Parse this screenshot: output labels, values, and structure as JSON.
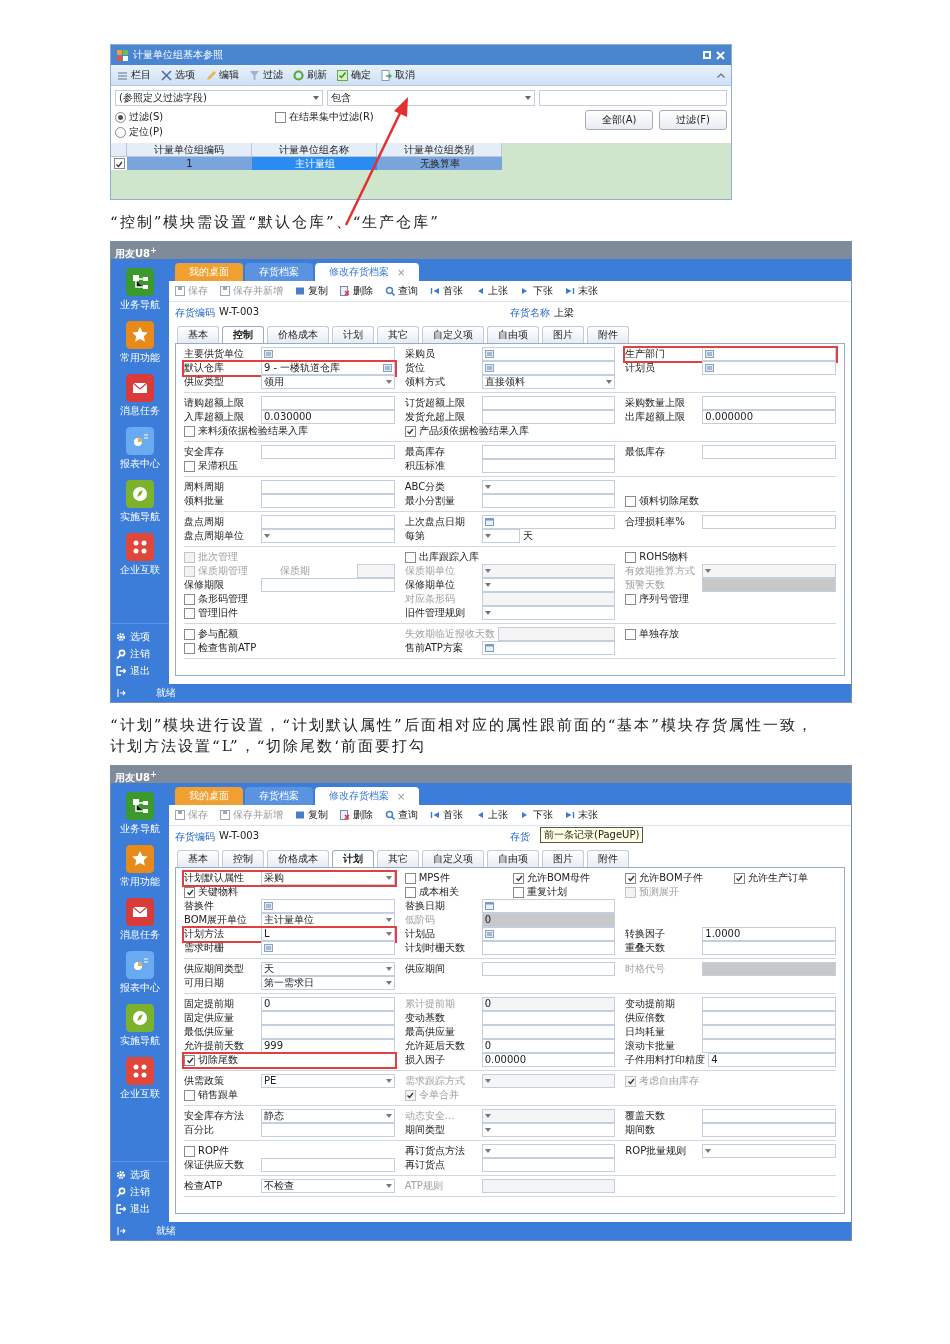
{
  "dialog": {
    "title": "计量单位组基本参照",
    "toolbar": [
      {
        "label": "栏目"
      },
      {
        "label": "选项"
      },
      {
        "label": "编辑"
      },
      {
        "label": "过滤"
      },
      {
        "label": "刷新"
      },
      {
        "label": "确定"
      },
      {
        "label": "取消"
      }
    ],
    "filter_field": "(参照定义过滤字段)",
    "filter_operator": "包含",
    "modes": [
      {
        "label": "过滤(S)",
        "selected": true
      },
      {
        "label": "定位(P)",
        "selected": false
      }
    ],
    "in_result": {
      "label": "在结果集中过滤(R)",
      "checked": false
    },
    "buttons": [
      "全部(A)",
      "过滤(F)"
    ],
    "table": {
      "columns": [
        "计量单位组编码",
        "计量单位组名称",
        "计量单位组类别"
      ],
      "rows": [
        {
          "checked": true,
          "selected": true,
          "cells": [
            {
              "text": "1",
              "focused": false
            },
            {
              "text": "主计量组",
              "focused": true
            },
            {
              "text": "无换算率",
              "focused": false
            }
          ]
        }
      ]
    }
  },
  "caption_1": "“控制”模块需设置“默认仓库”、“生产仓库”",
  "control_screen": {
    "app_title": "用友U8$^{+}$",
    "sidebar": {
      "items": [
        {
          "label": "业务导航",
          "color": "#3c9a2c"
        },
        {
          "label": "常用功能",
          "color": "#e88a1a"
        },
        {
          "label": "消息任务",
          "color": "#d93a3a"
        },
        {
          "label": "报表中心",
          "color": "#6aaaf0"
        },
        {
          "label": "实施导航",
          "color": "#7db32c"
        },
        {
          "label": "企业互联",
          "color": "#e0463a"
        }
      ],
      "bottom": [
        {
          "label": "选项"
        },
        {
          "label": "注销"
        },
        {
          "label": "退出"
        }
      ]
    },
    "tabs": [
      {
        "label": "我的桌面",
        "kind": "home",
        "selected": false
      },
      {
        "label": "存货档案",
        "kind": "doc",
        "selected": false
      },
      {
        "label": "修改存货档案",
        "kind": "doc",
        "selected": true,
        "close": "×"
      }
    ],
    "toolbar": [
      {
        "label": "保存",
        "disabled": true
      },
      {
        "label": "保存并新增",
        "disabled": true
      },
      {
        "label": "复制",
        "disabled": false
      },
      {
        "label": "删除",
        "disabled": false
      },
      {
        "label": "查询",
        "disabled": false
      },
      {
        "label": "首张",
        "disabled": false
      },
      {
        "label": "上张",
        "disabled": false
      },
      {
        "label": "下张",
        "disabled": false
      },
      {
        "label": "末张",
        "disabled": false
      }
    ],
    "header": {
      "code_label": "存货编码",
      "code_value": "W-T-003",
      "name_label": "存货名称",
      "name_value": "上梁"
    },
    "form_tabs": [
      {
        "label": "基本",
        "selected": false
      },
      {
        "label": "控制",
        "selected": true
      },
      {
        "label": "价格成本",
        "selected": false
      },
      {
        "label": "计划",
        "selected": false
      },
      {
        "label": "其它",
        "selected": false
      },
      {
        "label": "自定义项",
        "selected": false
      },
      {
        "label": "自由项",
        "selected": false
      },
      {
        "label": "图片",
        "selected": false
      },
      {
        "label": "附件",
        "selected": false
      }
    ],
    "sections": [
      {
        "rows": [
          [
            [
              {
                "kind": "ref",
                "label": "主要供货单位",
                "disabled": false,
                "marked": false
              }
            ],
            [
              {
                "kind": "ref",
                "label": "采购员",
                "disabled": false,
                "marked": false
              }
            ],
            [
              {
                "kind": "ref",
                "label": "生产部门",
                "disabled": false,
                "marked": true
              }
            ]
          ],
          [
            [
              {
                "kind": "ref",
                "label": "默认仓库",
                "value": "9 - 一楼轨道仓库",
                "disabled": false,
                "marked": true
              }
            ],
            [
              {
                "kind": "ref",
                "label": "货位",
                "disabled": false,
                "marked": false
              }
            ],
            [
              {
                "kind": "ref",
                "label": "计划员",
                "disabled": false,
                "marked": false
              }
            ]
          ],
          [
            [
              {
                "kind": "select",
                "label": "供应类型",
                "value": "领用",
                "disabled": false,
                "marked": false
              }
            ],
            [
              {
                "kind": "select",
                "label": "领料方式",
                "value": "直接领料",
                "disabled": false,
                "marked": false
              }
            ]
          ]
        ]
      },
      {
        "rows": [
          [
            [
              {
                "kind": "text",
                "label": "请购超额上限",
                "disabled": false,
                "marked": false
              }
            ],
            [
              {
                "kind": "text",
                "label": "订货超额上限",
                "disabled": false,
                "marked": false
              }
            ],
            [
              {
                "kind": "text",
                "label": "采购数量上限",
                "disabled": false,
                "marked": false
              }
            ]
          ],
          [
            [
              {
                "kind": "text",
                "label": "入库超额上限",
                "value": "0.030000",
                "disabled": false,
                "marked": false
              }
            ],
            [
              {
                "kind": "text",
                "label": "发货允超上限",
                "disabled": false,
                "marked": false
              }
            ],
            [
              {
                "kind": "text",
                "label": "出库超额上限",
                "value": "0.000000",
                "disabled": false,
                "marked": false
              }
            ]
          ],
          [
            [
              {
                "kind": "check",
                "label": "来料须依据检验结果入库",
                "checked": false,
                "disabled": false,
                "marked": false
              }
            ],
            [
              {
                "kind": "check",
                "label": "产品须依据检验结果入库",
                "checked": true,
                "disabled": false,
                "marked": false
              }
            ]
          ]
        ]
      },
      {
        "rows": [
          [
            [
              {
                "kind": "text",
                "label": "安全库存",
                "disabled": false,
                "marked": false
              }
            ],
            [
              {
                "kind": "text",
                "label": "最高库存",
                "disabled": false,
                "marked": false
              }
            ],
            [
              {
                "kind": "text",
                "label": "最低库存",
                "disabled": false,
                "marked": false
              }
            ]
          ],
          [
            [
              {
                "kind": "check",
                "label": "呆滞积压",
                "checked": false,
                "disabled": false,
                "marked": false
              }
            ],
            [
              {
                "kind": "text",
                "label": "积压标准",
                "disabled": false,
                "marked": false
              }
            ]
          ]
        ]
      },
      {
        "rows": [
          [
            [
              {
                "kind": "text",
                "label": "周料周期",
                "disabled": false,
                "marked": false
              }
            ],
            [
              {
                "kind": "select",
                "label": "ABC分类",
                "disabled": false,
                "marked": false
              }
            ]
          ],
          [
            [
              {
                "kind": "text",
                "label": "领料批量",
                "disabled": false,
                "marked": false
              }
            ],
            [
              {
                "kind": "text",
                "label": "最小分割量",
                "disabled": false,
                "marked": false
              }
            ],
            [
              {
                "kind": "check",
                "label": "领料切除尾数",
                "checked": false,
                "disabled": false,
                "marked": false
              }
            ]
          ]
        ]
      },
      {
        "rows": [
          [
            [
              {
                "kind": "text",
                "label": "盘点周期",
                "disabled": false,
                "marked": false
              }
            ],
            [
              {
                "kind": "date",
                "label": "上次盘点日期",
                "disabled": false,
                "marked": false
              }
            ],
            [
              {
                "kind": "text",
                "label": "合理损耗率%",
                "disabled": false,
                "marked": false
              }
            ]
          ],
          [
            [
              {
                "kind": "select",
                "label": "盘点周期单位",
                "disabled": false,
                "marked": false
              }
            ],
            [
              {
                "kind": "short_select",
                "label": "每第",
                "suffix": "天",
                "disabled": false,
                "marked": false
              }
            ]
          ]
        ]
      },
      {
        "rows": [
          [
            [
              {
                "kind": "check",
                "label": "批次管理",
                "checked": false,
                "disabled": true,
                "marked": false
              }
            ],
            [
              {
                "kind": "check",
                "label": "出库跟踪入库",
                "checked": false,
                "disabled": false,
                "marked": false
              }
            ],
            [
              {
                "kind": "check",
                "label": "ROHS物料",
                "checked": false,
                "disabled": false,
                "marked": false
              }
            ]
          ],
          [
            [
              {
                "kind": "check",
                "label": "保质期管理",
                "checked": false,
                "disabled": true,
                "marked": false
              },
              {
                "kind": "short_text",
                "label": "保质期",
                "disabled": true,
                "marked": false
              }
            ],
            [
              {
                "kind": "select",
                "label": "保质期单位",
                "disabled": true,
                "marked": false
              }
            ],
            [
              {
                "kind": "select",
                "label": "有效期推算方式",
                "disabled": true,
                "marked": false
              }
            ]
          ],
          [
            [
              {
                "kind": "text",
                "label": "保修期限",
                "disabled": false,
                "marked": false
              }
            ],
            [
              {
                "kind": "select",
                "label": "保修期单位",
                "disabled": false,
                "marked": false
              }
            ],
            [
              {
                "kind": "text",
                "label": "预警天数",
                "disabled": true,
                "marked": false
              }
            ]
          ],
          [
            [
              {
                "kind": "check",
                "label": "条形码管理",
                "checked": false,
                "disabled": false,
                "marked": false
              }
            ],
            [
              {
                "kind": "text",
                "label": "对应条形码",
                "disabled": true,
                "marked": false
              }
            ],
            [
              {
                "kind": "check",
                "label": "序列号管理",
                "checked": false,
                "disabled": false,
                "marked": false
              }
            ]
          ],
          [
            [
              {
                "kind": "check",
                "label": "管理旧件",
                "checked": false,
                "disabled": false,
                "marked": false
              }
            ],
            [
              {
                "kind": "select",
                "label": "旧件管理规则",
                "disabled": false,
                "marked": false
              }
            ]
          ]
        ]
      },
      {
        "rows": [
          [
            [
              {
                "kind": "check",
                "label": "参与配额",
                "checked": false,
                "disabled": false,
                "marked": false
              }
            ],
            [
              {
                "kind": "text",
                "label": "失效期临近报收天数",
                "disabled": true,
                "marked": false
              }
            ],
            [
              {
                "kind": "check",
                "label": "单独存放",
                "checked": false,
                "disabled": false,
                "marked": false
              }
            ]
          ],
          [
            [
              {
                "kind": "check",
                "label": "检查售前ATP",
                "checked": false,
                "disabled": false,
                "marked": false
              }
            ],
            [
              {
                "kind": "date",
                "label": "售前ATP方案",
                "disabled": false,
                "marked": false
              }
            ]
          ]
        ]
      }
    ],
    "status": "就绪"
  },
  "caption_2": "“计划”模块进行设置，“计划默认属性”后面相对应的属性跟前面的“基本”模块存货属性一致，计划方法设置“L”，“切除尾数‘前面要打勾",
  "plan_screen": {
    "app_title": "用友U8$^{+}$",
    "sidebar": {
      "items": [
        {
          "label": "业务导航",
          "color": "#3c9a2c"
        },
        {
          "label": "常用功能",
          "color": "#e88a1a"
        },
        {
          "label": "消息任务",
          "color": "#d93a3a"
        },
        {
          "label": "报表中心",
          "color": "#6aaaf0"
        },
        {
          "label": "实施导航",
          "color": "#7db32c"
        },
        {
          "label": "企业互联",
          "color": "#e0463a"
        }
      ],
      "bottom": [
        {
          "label": "选项"
        },
        {
          "label": "注销"
        },
        {
          "label": "退出"
        }
      ]
    },
    "tabs": [
      {
        "label": "我的桌面",
        "kind": "home",
        "selected": false
      },
      {
        "label": "存货档案",
        "kind": "doc",
        "selected": false
      },
      {
        "label": "修改存货档案",
        "kind": "doc",
        "selected": true,
        "close": "×"
      }
    ],
    "toolbar": [
      {
        "label": "保存",
        "disabled": true
      },
      {
        "label": "保存并新增",
        "disabled": true
      },
      {
        "label": "复制",
        "disabled": false
      },
      {
        "label": "删除",
        "disabled": false
      },
      {
        "label": "查询",
        "disabled": false
      },
      {
        "label": "首张",
        "disabled": false
      },
      {
        "label": "上张",
        "disabled": false
      },
      {
        "label": "下张",
        "disabled": false
      },
      {
        "label": "末张",
        "disabled": false
      }
    ],
    "header": {
      "code_label": "存货编码",
      "code_value": "W-T-003",
      "name_label": "存货"
    },
    "tooltip": "前一条记录(PageUP)",
    "form_tabs": [
      {
        "label": "基本",
        "selected": false
      },
      {
        "label": "控制",
        "selected": false
      },
      {
        "label": "价格成本",
        "selected": false
      },
      {
        "label": "计划",
        "selected": true
      },
      {
        "label": "其它",
        "selected": false
      },
      {
        "label": "自定义项",
        "selected": false
      },
      {
        "label": "自由项",
        "selected": false
      },
      {
        "label": "图片",
        "selected": false
      },
      {
        "label": "附件",
        "selected": false
      }
    ],
    "sections": [
      {
        "rows": [
          [
            [
              {
                "kind": "select",
                "label": "计划默认属性",
                "value": "采购",
                "disabled": false,
                "marked": true
              }
            ],
            [
              {
                "kind": "check",
                "label": "MPS件",
                "checked": false,
                "disabled": false,
                "marked": false
              },
              {
                "kind": "check",
                "label": "允许BOM母件",
                "checked": true,
                "disabled": false,
                "marked": false
              }
            ],
            [
              {
                "kind": "check",
                "label": "允许BOM子件",
                "checked": true,
                "disabled": false,
                "marked": false
              },
              {
                "kind": "check",
                "label": "允许生产订单",
                "checked": true,
                "disabled": false,
                "marked": false
              }
            ]
          ],
          [
            [
              {
                "kind": "check",
                "label": "关键物料",
                "checked": true,
                "disabled": false,
                "marked": false
              }
            ],
            [
              {
                "kind": "check",
                "label": "成本相关",
                "checked": false,
                "disabled": false,
                "marked": false
              },
              {
                "kind": "check",
                "label": "重复计划",
                "checked": false,
                "disabled": false,
                "marked": false
              }
            ],
            [
              {
                "kind": "check",
                "label": "预测展开",
                "checked": false,
                "disabled": true,
                "marked": false
              }
            ]
          ],
          [
            [
              {
                "kind": "ref",
                "label": "替换件",
                "disabled": false,
                "marked": false
              }
            ],
            [
              {
                "kind": "date",
                "label": "替换日期",
                "disabled": false,
                "marked": false
              }
            ]
          ],
          [
            [
              {
                "kind": "select",
                "label": "BOM展开单位",
                "value": "主计量单位",
                "disabled": false,
                "marked": false
              }
            ],
            [
              {
                "kind": "text",
                "label": "低阶码",
                "value": "0",
                "disabled": true,
                "marked": false
              }
            ]
          ],
          [
            [
              {
                "kind": "select",
                "label": "计划方法",
                "value": "L",
                "disabled": false,
                "marked": true
              }
            ],
            [
              {
                "kind": "ref",
                "label": "计划品",
                "disabled": false,
                "marked": false
              }
            ],
            [
              {
                "kind": "text",
                "label": "转换因子",
                "value": "1.0000",
                "disabled": false,
                "marked": false
              }
            ]
          ],
          [
            [
              {
                "kind": "ref",
                "label": "需求时栅",
                "disabled": false,
                "marked": false
              }
            ],
            [
              {
                "kind": "text",
                "label": "计划时栅天数",
                "disabled": false,
                "marked": false
              }
            ],
            [
              {
                "kind": "text",
                "label": "重叠天数",
                "disabled": false,
                "marked": false
              }
            ]
          ]
        ]
      },
      {
        "rows": [
          [
            [
              {
                "kind": "select",
                "label": "供应期间类型",
                "value": "天",
                "disabled": false,
                "marked": false
              }
            ],
            [
              {
                "kind": "text",
                "label": "供应期间",
                "disabled": false,
                "marked": false
              }
            ],
            [
              {
                "kind": "text",
                "label": "时格代号",
                "disabled": true,
                "marked": false
              }
            ]
          ],
          [
            [
              {
                "kind": "select",
                "label": "可用日期",
                "value": "第一需求日",
                "disabled": false,
                "marked": false
              }
            ]
          ]
        ]
      },
      {
        "rows": [
          [
            [
              {
                "kind": "text",
                "label": "固定提前期",
                "value": "0",
                "disabled": false,
                "marked": false
              }
            ],
            [
              {
                "kind": "text",
                "label": "累计提前期",
                "value": "0",
                "disabled": true,
                "marked": false
              }
            ],
            [
              {
                "kind": "text",
                "label": "变动提前期",
                "disabled": false,
                "marked": false
              }
            ]
          ],
          [
            [
              {
                "kind": "text",
                "label": "固定供应量",
                "disabled": false,
                "marked": false
              }
            ],
            [
              {
                "kind": "text",
                "label": "变动基数",
                "disabled": false,
                "marked": false
              }
            ],
            [
              {
                "kind": "text",
                "label": "供应倍数",
                "disabled": false,
                "marked": false
              }
            ]
          ],
          [
            [
              {
                "kind": "text",
                "label": "最低供应量",
                "disabled": false,
                "marked": false
              }
            ],
            [
              {
                "kind": "text",
                "label": "最高供应量",
                "disabled": false,
                "marked": false
              }
            ],
            [
              {
                "kind": "text",
                "label": "日均耗量",
                "disabled": false,
                "marked": false
              }
            ]
          ],
          [
            [
              {
                "kind": "text",
                "label": "允许提前天数",
                "value": "999",
                "disabled": false,
                "marked": false
              }
            ],
            [
              {
                "kind": "text",
                "label": "允许延后天数",
                "value": "0",
                "disabled": false,
                "marked": false
              }
            ],
            [
              {
                "kind": "text",
                "label": "滚动卡批量",
                "disabled": false,
                "marked": false
              }
            ]
          ],
          [
            [
              {
                "kind": "check",
                "label": "切除尾数",
                "checked": true,
                "disabled": false,
                "marked": true
              }
            ],
            [
              {
                "kind": "text",
                "label": "损入因子",
                "value": "0.00000",
                "disabled": false,
                "marked": false
              }
            ],
            [
              {
                "kind": "text",
                "label": "子件用料打印精度",
                "value": "4",
                "disabled": false,
                "marked": false
              }
            ]
          ]
        ]
      },
      {
        "rows": [
          [
            [
              {
                "kind": "select",
                "label": "供需政策",
                "value": "PE",
                "disabled": false,
                "marked": false
              }
            ],
            [
              {
                "kind": "select",
                "label": "需求跟踪方式",
                "disabled": true,
                "marked": false
              }
            ],
            [
              {
                "kind": "check",
                "label": "考虑自由库存",
                "checked": true,
                "disabled": true,
                "marked": false
              }
            ]
          ],
          [
            [
              {
                "kind": "check",
                "label": "销售跟单",
                "checked": false,
                "disabled": false,
                "marked": false
              }
            ],
            [
              {
                "kind": "check",
                "label": "令单合并",
                "checked": true,
                "disabled": true,
                "marked": false
              }
            ]
          ]
        ]
      },
      {
        "rows": [
          [
            [
              {
                "kind": "select",
                "label": "安全库存方法",
                "value": "静态",
                "disabled": false,
                "marked": false
              }
            ],
            [
              {
                "kind": "select",
                "label": "动态安全…",
                "disabled": true,
                "marked": false
              }
            ],
            [
              {
                "kind": "text",
                "label": "覆盖天数",
                "disabled": false,
                "marked": false
              }
            ]
          ],
          [
            [
              {
                "kind": "text",
                "label": "百分比",
                "disabled": false,
                "marked": false
              }
            ],
            [
              {
                "kind": "select",
                "label": "期间类型",
                "disabled": false,
                "marked": false
              }
            ],
            [
              {
                "kind": "text",
                "label": "期间数",
                "disabled": false,
                "marked": false
              }
            ]
          ]
        ]
      },
      {
        "rows": [
          [
            [
              {
                "kind": "check",
                "label": "ROP件",
                "checked": false,
                "disabled": false,
                "marked": false
              }
            ],
            [
              {
                "kind": "select",
                "label": "再订货点方法",
                "disabled": false,
                "marked": false
              }
            ],
            [
              {
                "kind": "select",
                "label": "ROP批量规则",
                "disabled": false,
                "marked": false
              }
            ]
          ],
          [
            [
              {
                "kind": "text",
                "label": "保证供应天数",
                "disabled": false,
                "marked": false
              }
            ],
            [
              {
                "kind": "text",
                "label": "再订货点",
                "disabled": false,
                "marked": false
              }
            ]
          ]
        ]
      },
      {
        "rows": [
          [
            [
              {
                "kind": "select",
                "label": "检查ATP",
                "value": "不检查",
                "disabled": false,
                "marked": false
              }
            ],
            [
              {
                "kind": "text",
                "label": "ATP规则",
                "disabled": true,
                "marked": false
              }
            ]
          ]
        ]
      }
    ],
    "status": "就绪"
  }
}
